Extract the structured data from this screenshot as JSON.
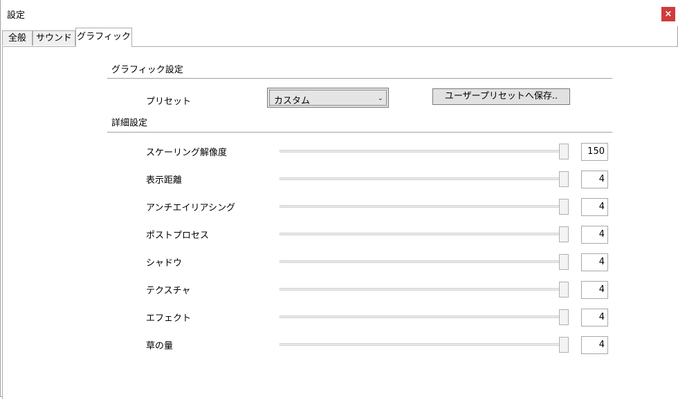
{
  "window": {
    "title": "設定",
    "close_label": "×"
  },
  "tabs": [
    {
      "label": "全般"
    },
    {
      "label": "サウンド"
    },
    {
      "label": "グラフィック"
    }
  ],
  "graphics": {
    "section_title": "グラフィック設定",
    "preset_label": "プリセット",
    "preset_value": "カスタム",
    "save_preset_button": "ユーザープリセットへ保存.."
  },
  "details": {
    "section_title": "詳細設定",
    "settings": [
      {
        "label": "スケーリング解像度",
        "value": "150"
      },
      {
        "label": "表示距離",
        "value": "4"
      },
      {
        "label": "アンチエイリアシング",
        "value": "4"
      },
      {
        "label": "ポストプロセス",
        "value": "4"
      },
      {
        "label": "シャドウ",
        "value": "4"
      },
      {
        "label": "テクスチャ",
        "value": "4"
      },
      {
        "label": "エフェクト",
        "value": "4"
      },
      {
        "label": "草の量",
        "value": "4"
      }
    ]
  }
}
